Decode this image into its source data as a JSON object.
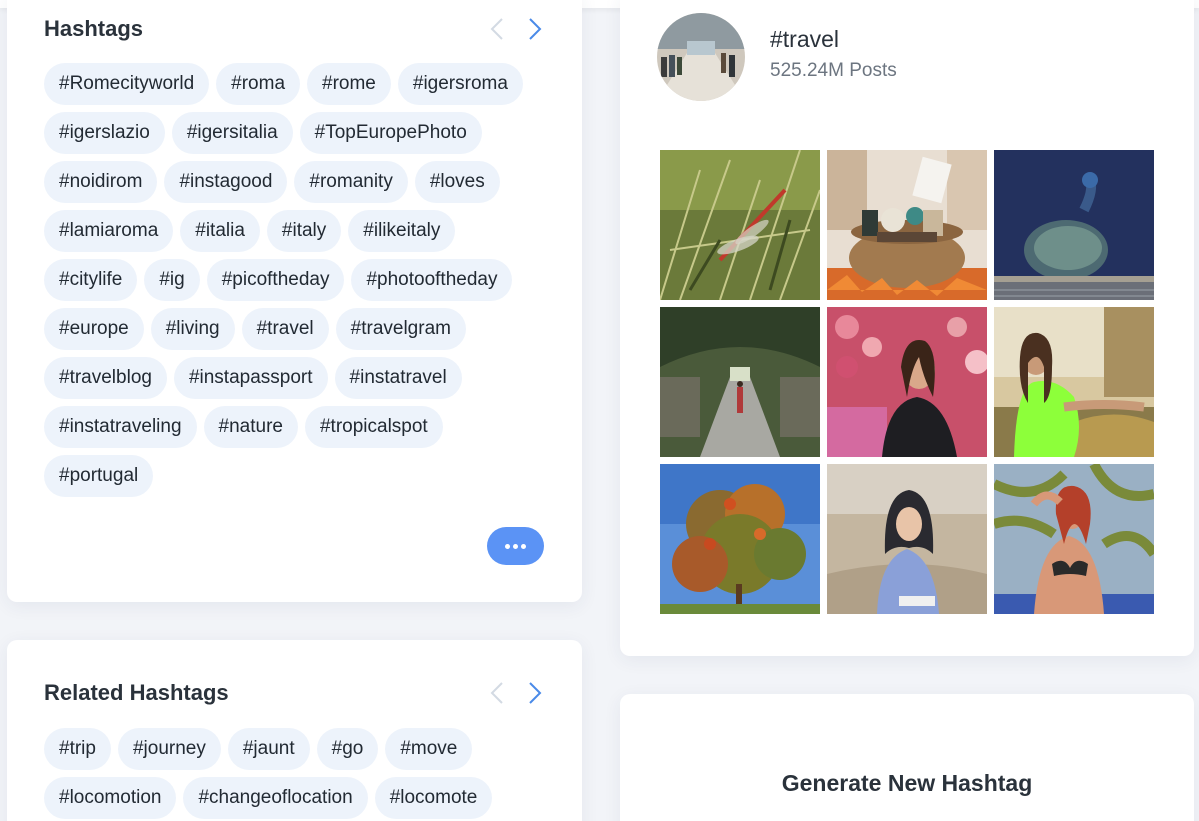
{
  "hashtags_card": {
    "title": "Hashtags",
    "tags": [
      "#Romecityworld",
      "#roma",
      "#rome",
      "#igersroma",
      "#igerslazio",
      "#igersitalia",
      "#TopEuropePhoto",
      "#noidirom",
      "#instagood",
      "#romanity",
      "#loves",
      "#lamiaroma",
      "#italia",
      "#italy",
      "#ilikeitaly",
      "#citylife",
      "#ig",
      "#picoftheday",
      "#photooftheday",
      "#europe",
      "#living",
      "#travel",
      "#travelgram",
      "#travelblog",
      "#instapassport",
      "#instatravel",
      "#instatraveling",
      "#nature",
      "#tropicalspot",
      "#portugal"
    ],
    "prev_icon": "chevron-left-icon",
    "next_icon": "chevron-right-icon",
    "more_icon": "more-dots-icon"
  },
  "related_card": {
    "title": "Related Hashtags",
    "tags": [
      "#trip",
      "#journey",
      "#jaunt",
      "#go",
      "#move",
      "#locomotion",
      "#changeoflocation",
      "#locomote"
    ],
    "prev_icon": "chevron-left-icon",
    "next_icon": "chevron-right-icon"
  },
  "travel_card": {
    "hashtag": "#travel",
    "posts": "525.24M Posts",
    "photos": [
      "dragonfly",
      "gift-basket",
      "peacock",
      "tunnel-walkway",
      "woman-flowers",
      "woman-neon-shirt",
      "autumn-tree",
      "woman-hijab",
      "woman-palm"
    ]
  },
  "generate_card": {
    "title": "Generate New Hashtag"
  },
  "colors": {
    "accent": "#5b93f5",
    "tag_bg": "#edf3fb",
    "page_bg": "#f2f4f8",
    "chevron_active": "#4a8ae8",
    "chevron_inactive": "#d3dae3"
  }
}
